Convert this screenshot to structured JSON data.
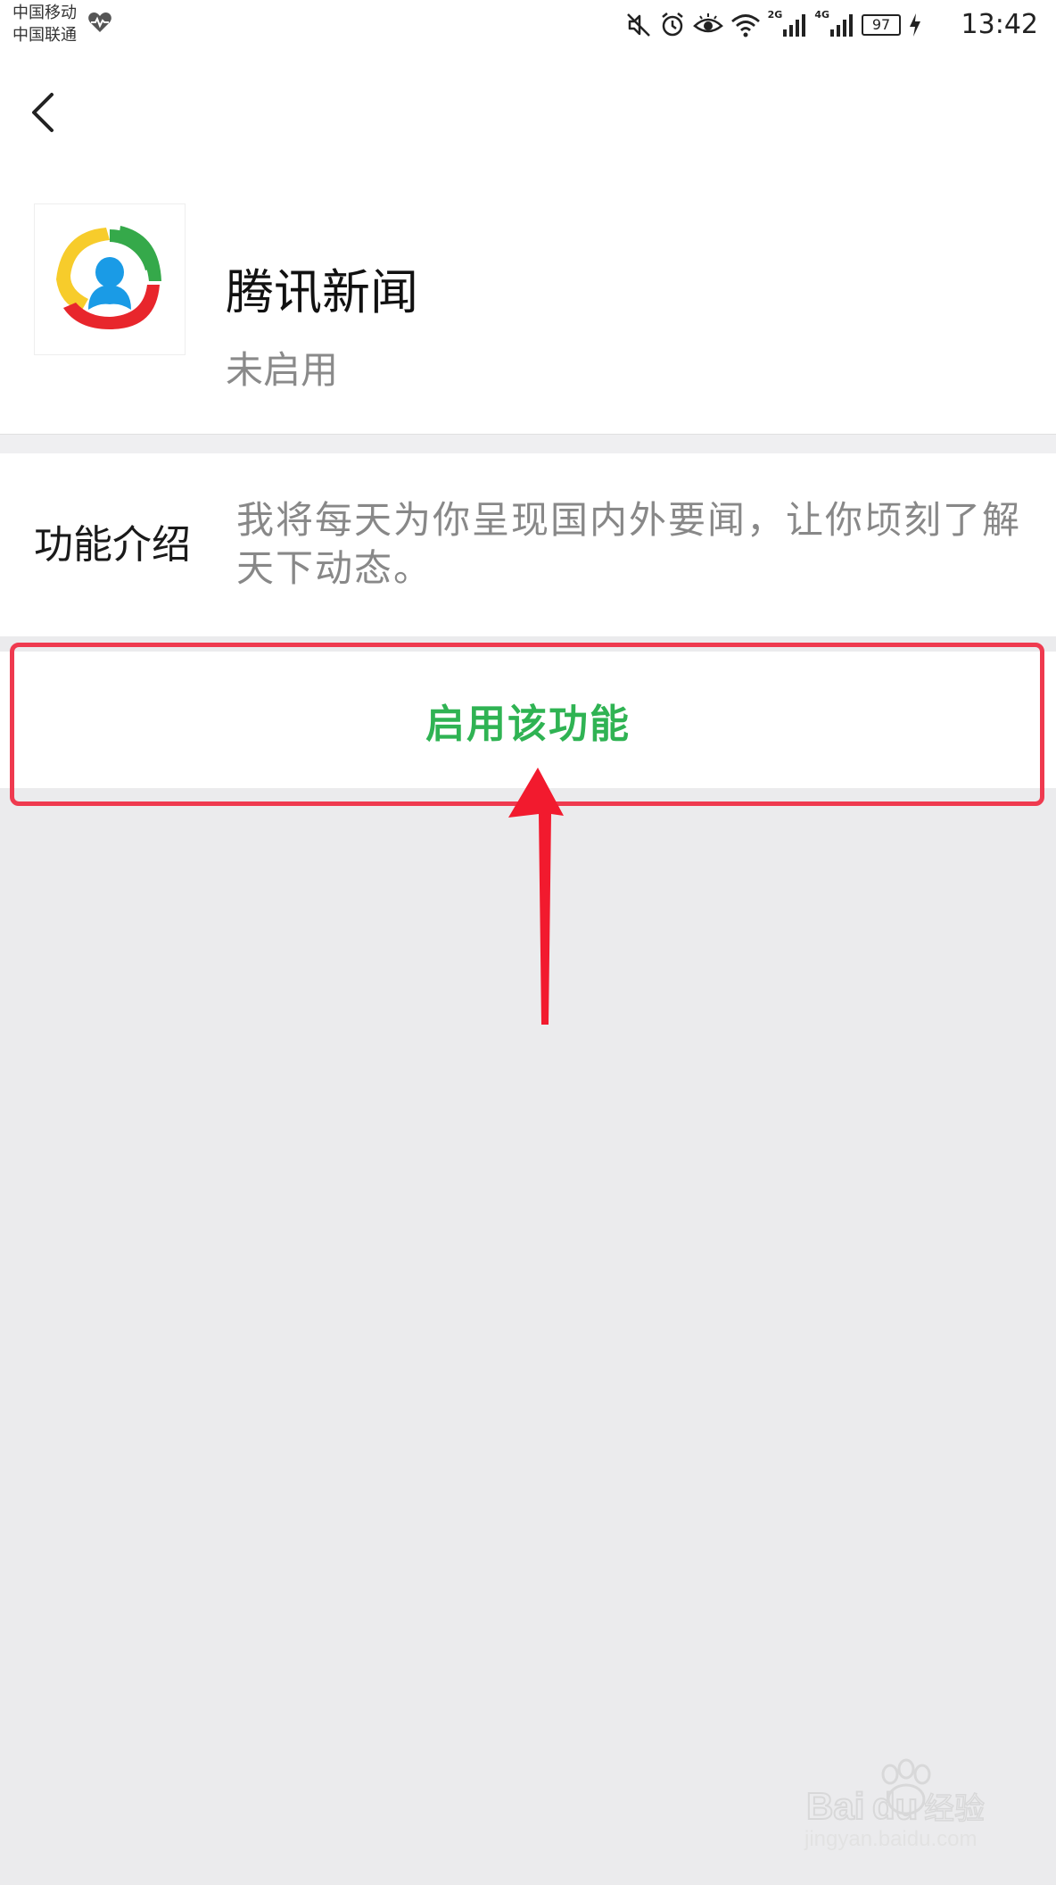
{
  "status_bar": {
    "carrier_line_1": "中国移动",
    "carrier_line_2": "中国联通",
    "net_2g": "2G",
    "net_4g": "4G",
    "battery_level": "97",
    "time": "13:42"
  },
  "header": {
    "app_name": "腾讯新闻",
    "app_status": "未启用"
  },
  "intro": {
    "label": "功能介绍",
    "text": "我将每天为你呈现国内外要闻，让你顷刻了解天下动态。"
  },
  "actions": {
    "enable_label": "启用该功能"
  },
  "watermark": {
    "brand": "Baidu 经验",
    "url": "jingyan.baidu.com"
  },
  "colors": {
    "accent_green": "#2fb353",
    "annotation_red": "#ef3a4f",
    "background": "#ebebed"
  }
}
